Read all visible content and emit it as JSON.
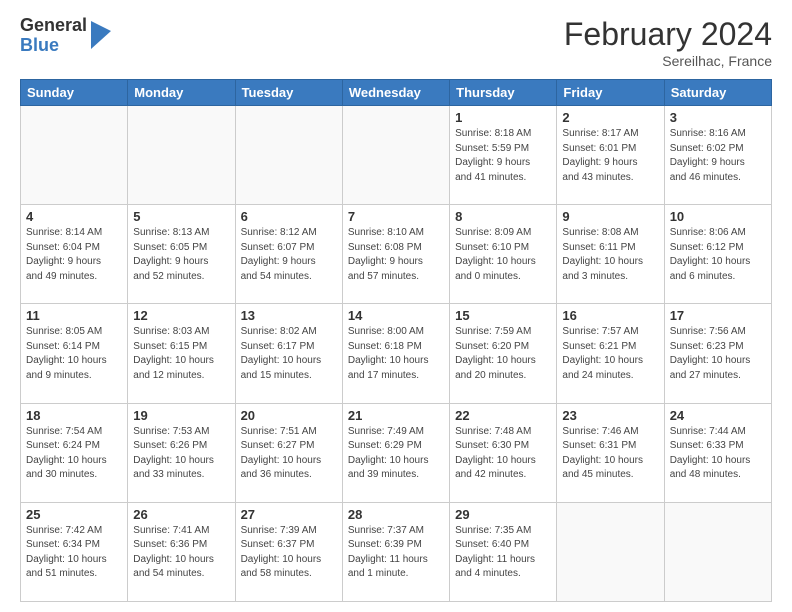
{
  "header": {
    "logo_general": "General",
    "logo_blue": "Blue",
    "month_title": "February 2024",
    "location": "Sereilhac, France"
  },
  "days_of_week": [
    "Sunday",
    "Monday",
    "Tuesday",
    "Wednesday",
    "Thursday",
    "Friday",
    "Saturday"
  ],
  "weeks": [
    [
      {
        "day": "",
        "info": ""
      },
      {
        "day": "",
        "info": ""
      },
      {
        "day": "",
        "info": ""
      },
      {
        "day": "",
        "info": ""
      },
      {
        "day": "1",
        "info": "Sunrise: 8:18 AM\nSunset: 5:59 PM\nDaylight: 9 hours\nand 41 minutes."
      },
      {
        "day": "2",
        "info": "Sunrise: 8:17 AM\nSunset: 6:01 PM\nDaylight: 9 hours\nand 43 minutes."
      },
      {
        "day": "3",
        "info": "Sunrise: 8:16 AM\nSunset: 6:02 PM\nDaylight: 9 hours\nand 46 minutes."
      }
    ],
    [
      {
        "day": "4",
        "info": "Sunrise: 8:14 AM\nSunset: 6:04 PM\nDaylight: 9 hours\nand 49 minutes."
      },
      {
        "day": "5",
        "info": "Sunrise: 8:13 AM\nSunset: 6:05 PM\nDaylight: 9 hours\nand 52 minutes."
      },
      {
        "day": "6",
        "info": "Sunrise: 8:12 AM\nSunset: 6:07 PM\nDaylight: 9 hours\nand 54 minutes."
      },
      {
        "day": "7",
        "info": "Sunrise: 8:10 AM\nSunset: 6:08 PM\nDaylight: 9 hours\nand 57 minutes."
      },
      {
        "day": "8",
        "info": "Sunrise: 8:09 AM\nSunset: 6:10 PM\nDaylight: 10 hours\nand 0 minutes."
      },
      {
        "day": "9",
        "info": "Sunrise: 8:08 AM\nSunset: 6:11 PM\nDaylight: 10 hours\nand 3 minutes."
      },
      {
        "day": "10",
        "info": "Sunrise: 8:06 AM\nSunset: 6:12 PM\nDaylight: 10 hours\nand 6 minutes."
      }
    ],
    [
      {
        "day": "11",
        "info": "Sunrise: 8:05 AM\nSunset: 6:14 PM\nDaylight: 10 hours\nand 9 minutes."
      },
      {
        "day": "12",
        "info": "Sunrise: 8:03 AM\nSunset: 6:15 PM\nDaylight: 10 hours\nand 12 minutes."
      },
      {
        "day": "13",
        "info": "Sunrise: 8:02 AM\nSunset: 6:17 PM\nDaylight: 10 hours\nand 15 minutes."
      },
      {
        "day": "14",
        "info": "Sunrise: 8:00 AM\nSunset: 6:18 PM\nDaylight: 10 hours\nand 17 minutes."
      },
      {
        "day": "15",
        "info": "Sunrise: 7:59 AM\nSunset: 6:20 PM\nDaylight: 10 hours\nand 20 minutes."
      },
      {
        "day": "16",
        "info": "Sunrise: 7:57 AM\nSunset: 6:21 PM\nDaylight: 10 hours\nand 24 minutes."
      },
      {
        "day": "17",
        "info": "Sunrise: 7:56 AM\nSunset: 6:23 PM\nDaylight: 10 hours\nand 27 minutes."
      }
    ],
    [
      {
        "day": "18",
        "info": "Sunrise: 7:54 AM\nSunset: 6:24 PM\nDaylight: 10 hours\nand 30 minutes."
      },
      {
        "day": "19",
        "info": "Sunrise: 7:53 AM\nSunset: 6:26 PM\nDaylight: 10 hours\nand 33 minutes."
      },
      {
        "day": "20",
        "info": "Sunrise: 7:51 AM\nSunset: 6:27 PM\nDaylight: 10 hours\nand 36 minutes."
      },
      {
        "day": "21",
        "info": "Sunrise: 7:49 AM\nSunset: 6:29 PM\nDaylight: 10 hours\nand 39 minutes."
      },
      {
        "day": "22",
        "info": "Sunrise: 7:48 AM\nSunset: 6:30 PM\nDaylight: 10 hours\nand 42 minutes."
      },
      {
        "day": "23",
        "info": "Sunrise: 7:46 AM\nSunset: 6:31 PM\nDaylight: 10 hours\nand 45 minutes."
      },
      {
        "day": "24",
        "info": "Sunrise: 7:44 AM\nSunset: 6:33 PM\nDaylight: 10 hours\nand 48 minutes."
      }
    ],
    [
      {
        "day": "25",
        "info": "Sunrise: 7:42 AM\nSunset: 6:34 PM\nDaylight: 10 hours\nand 51 minutes."
      },
      {
        "day": "26",
        "info": "Sunrise: 7:41 AM\nSunset: 6:36 PM\nDaylight: 10 hours\nand 54 minutes."
      },
      {
        "day": "27",
        "info": "Sunrise: 7:39 AM\nSunset: 6:37 PM\nDaylight: 10 hours\nand 58 minutes."
      },
      {
        "day": "28",
        "info": "Sunrise: 7:37 AM\nSunset: 6:39 PM\nDaylight: 11 hours\nand 1 minute."
      },
      {
        "day": "29",
        "info": "Sunrise: 7:35 AM\nSunset: 6:40 PM\nDaylight: 11 hours\nand 4 minutes."
      },
      {
        "day": "",
        "info": ""
      },
      {
        "day": "",
        "info": ""
      }
    ]
  ]
}
